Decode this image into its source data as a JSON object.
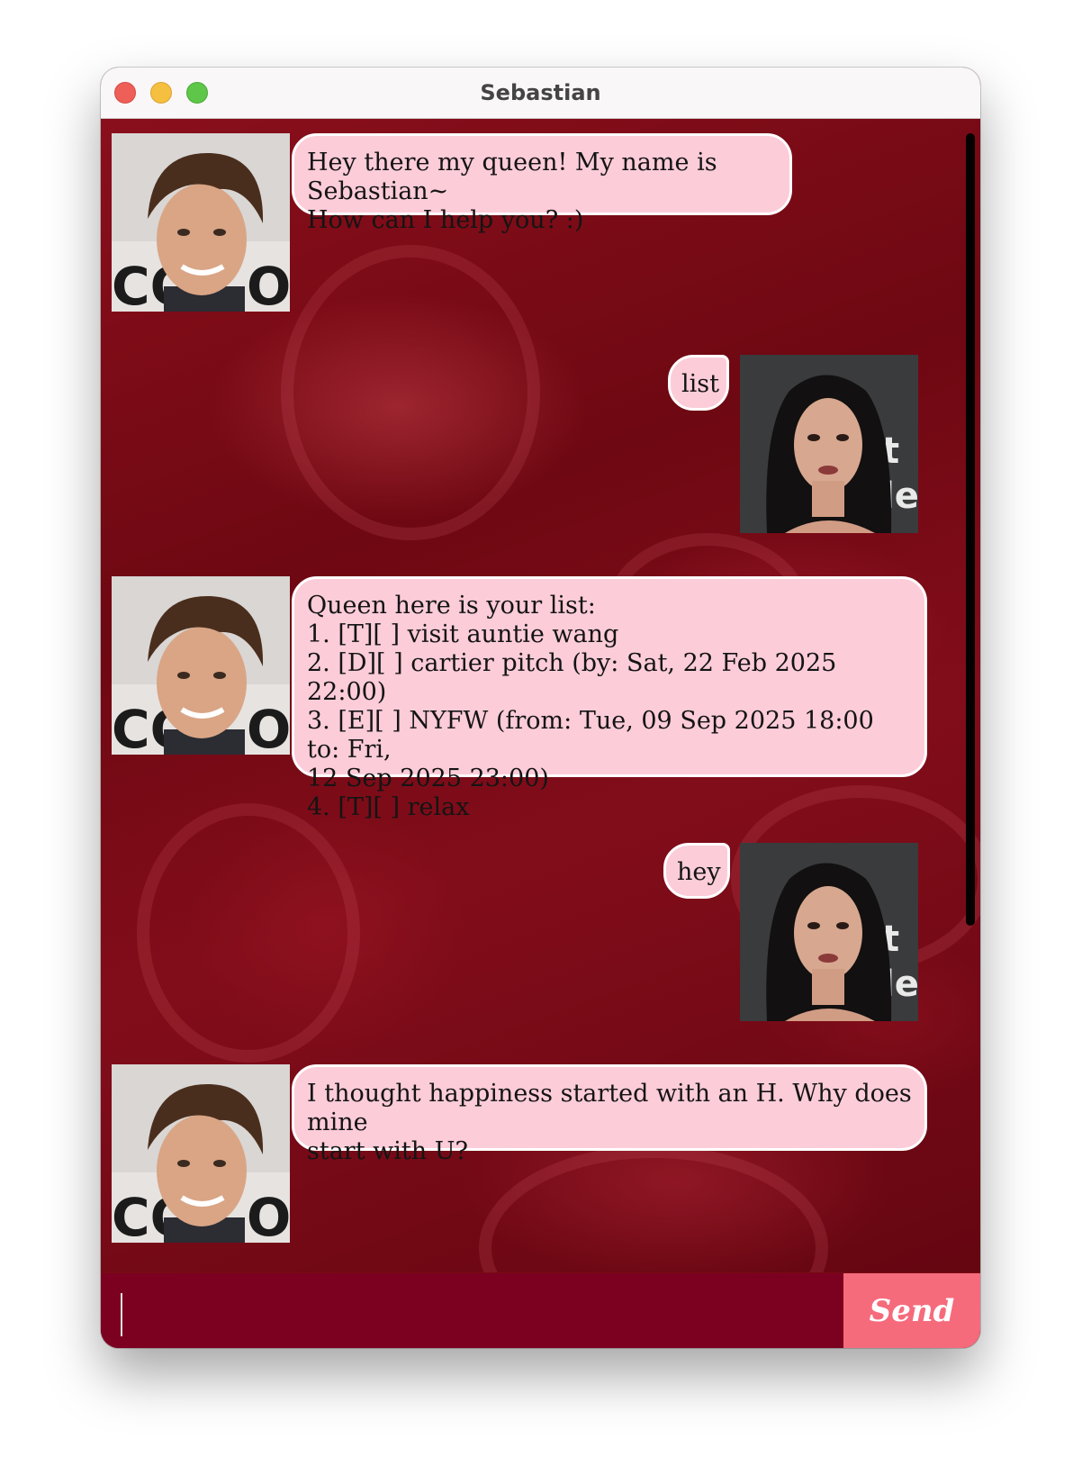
{
  "window": {
    "title": "Sebastian"
  },
  "messages": [
    {
      "sender": "bot",
      "text": "Hey there my queen! My name is Sebastian~\nHow can I help you? :)"
    },
    {
      "sender": "user",
      "text": "list"
    },
    {
      "sender": "bot",
      "text": "Queen here is your list:\n1. [T][ ] visit auntie wang\n2. [D][ ] cartier pitch (by: Sat, 22 Feb 2025 22:00)\n3. [E][ ] NYFW (from: Tue, 09 Sep 2025 18:00 to: Fri,\n12 Sep 2025 23:00)\n4. [T][ ] relax"
    },
    {
      "sender": "user",
      "text": "hey"
    },
    {
      "sender": "bot",
      "text": "I thought happiness started with an H. Why does mine\nstart with U?"
    }
  ],
  "input": {
    "value": "",
    "placeholder": ""
  },
  "send_button": {
    "label": "Send"
  },
  "colors": {
    "bubble": "#fcccd9",
    "chat_background": "#7a0a14",
    "input_bar": "#7c0020",
    "send_button": "#f56b7c"
  }
}
